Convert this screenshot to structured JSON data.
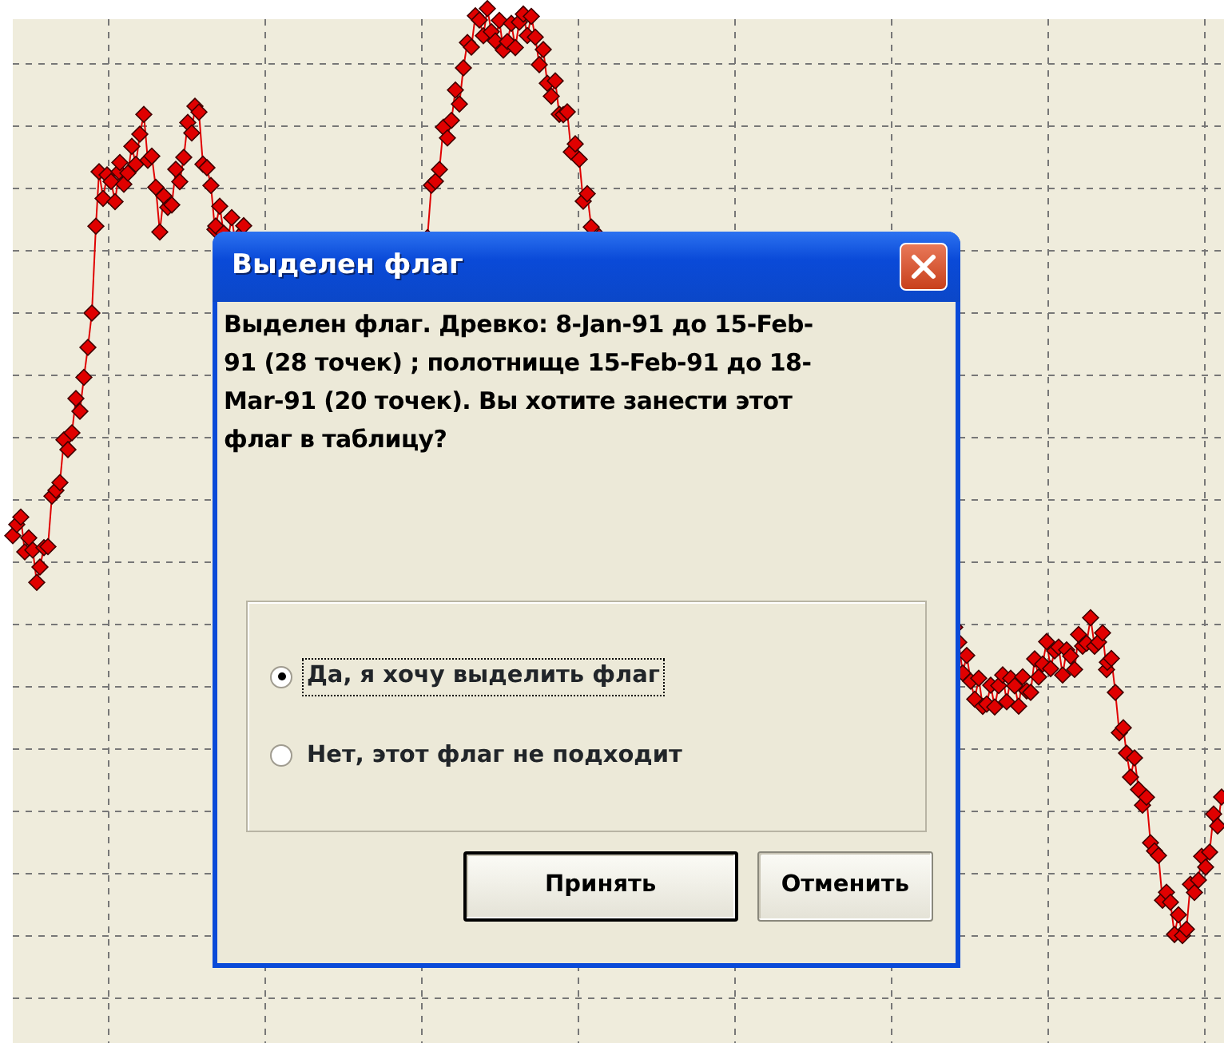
{
  "dialog": {
    "title": "Выделен флаг",
    "message": "Выделен флаг. Древко: 8-Jan-91 до 15-Feb-91 (28 точек) ; полотнище 15-Feb-91 до 18-Mar-91 (20 точек). Вы хотите занести этот флаг в таблицу?",
    "options": [
      {
        "label": "Да, я хочу выделить флаг",
        "selected": true,
        "focused": true
      },
      {
        "label": "Нет, этот флаг не подходит",
        "selected": false,
        "focused": false
      }
    ],
    "buttons": [
      {
        "label": "Принять",
        "default": true
      },
      {
        "label": "Отменить",
        "default": false
      }
    ]
  }
}
